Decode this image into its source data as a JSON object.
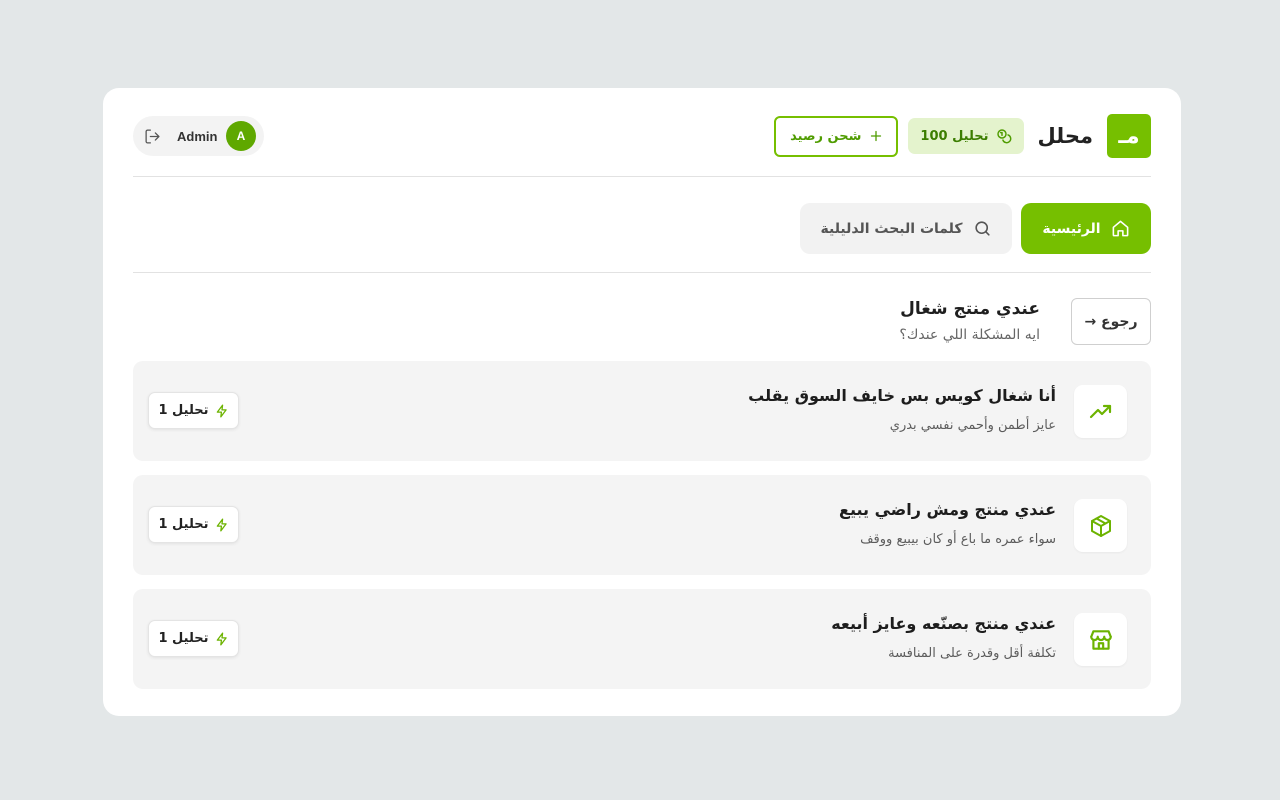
{
  "brand": {
    "name": "محلل",
    "logo_glyph": "مـ",
    "accent_color": "#76bf00"
  },
  "header": {
    "credits_label": "100 تحليل",
    "topup_label": "شحن رصيد",
    "user_name": "Admin",
    "user_initial": "A"
  },
  "nav": {
    "tabs": [
      {
        "label": "الرئيسية",
        "icon": "home-icon",
        "active": true
      },
      {
        "label": "كلمات البحث الدليلية",
        "icon": "search-icon",
        "active": false
      }
    ]
  },
  "page": {
    "title": "عندي منتج شغال",
    "subtitle": "ايه المشكلة اللي عندك؟",
    "back_label": "رجوع →"
  },
  "options": [
    {
      "title": "أنا شغال كويس بس خايف السوق يقلب",
      "description": "عايز أطمن وأحمي نفسي بدري",
      "cost": "1 تحليل",
      "icon": "trending-up-icon"
    },
    {
      "title": "عندي منتج ومش راضي يبيع",
      "description": "سواء عمره ما باع أو كان بيبيع ووقف",
      "cost": "1 تحليل",
      "icon": "package-icon"
    },
    {
      "title": "عندي منتج بصنّعه وعايز أبيعه",
      "description": "تكلفة أقل وقدرة على المنافسة",
      "cost": "1 تحليل",
      "icon": "store-icon"
    }
  ]
}
